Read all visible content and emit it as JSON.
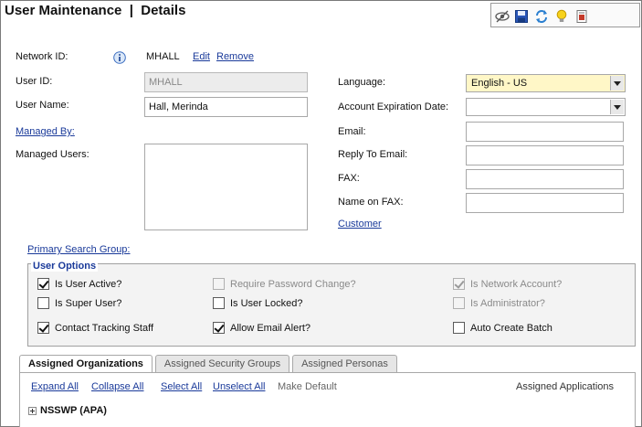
{
  "header": {
    "title": "User Maintenance  |  Details",
    "toolbar_icons": [
      "view-icon",
      "save-icon",
      "refresh-icon",
      "lightbulb-icon",
      "report-icon"
    ]
  },
  "form": {
    "network_id": {
      "label": "Network ID:",
      "value": "MHALL",
      "edit": "Edit",
      "remove": "Remove",
      "icon": "info-icon"
    },
    "user_id": {
      "label": "User ID:",
      "value": "MHALL"
    },
    "user_name": {
      "label": "User Name:",
      "value": "Hall, Merinda"
    },
    "managed_by": {
      "label": "Managed By:"
    },
    "managed_users": {
      "label": "Managed Users:"
    },
    "language": {
      "label": "Language:",
      "value": "English - US"
    },
    "account_expiration": {
      "label": "Account Expiration Date:",
      "value": ""
    },
    "email": {
      "label": "Email:",
      "value": ""
    },
    "reply_to": {
      "label": "Reply To Email:",
      "value": ""
    },
    "fax": {
      "label": "FAX:",
      "value": ""
    },
    "name_on_fax": {
      "label": "Name on FAX:",
      "value": ""
    },
    "customer": {
      "label": "Customer"
    },
    "primary_search_group": {
      "label": "Primary Search Group:"
    }
  },
  "user_options": {
    "title": "User Options",
    "items": [
      {
        "label": "Is User Active?",
        "checked": true,
        "disabled": false
      },
      {
        "label": "Require Password Change?",
        "checked": false,
        "disabled": true
      },
      {
        "label": "Is Network Account?",
        "checked": true,
        "disabled": true
      },
      {
        "label": "Is Super User?",
        "checked": false,
        "disabled": false
      },
      {
        "label": "Is User Locked?",
        "checked": false,
        "disabled": false
      },
      {
        "label": "Is Administrator?",
        "checked": false,
        "disabled": true
      },
      {
        "label": "Contact Tracking Staff",
        "checked": true,
        "disabled": false
      },
      {
        "label": "Allow Email Alert?",
        "checked": true,
        "disabled": false
      },
      {
        "label": "Auto Create Batch",
        "checked": false,
        "disabled": false
      }
    ]
  },
  "tabs": [
    {
      "label": "Assigned Organizations",
      "active": true
    },
    {
      "label": "Assigned Security Groups",
      "active": false
    },
    {
      "label": "Assigned Personas",
      "active": false
    }
  ],
  "org_actions": {
    "expand_all": "Expand All",
    "collapse_all": "Collapse All",
    "select_all": "Select All",
    "unselect_all": "Unselect All",
    "make_default": "Make Default",
    "assigned_applications": "Assigned Applications"
  },
  "tree": {
    "items": [
      {
        "label": "NSSWP (APA)"
      }
    ]
  }
}
